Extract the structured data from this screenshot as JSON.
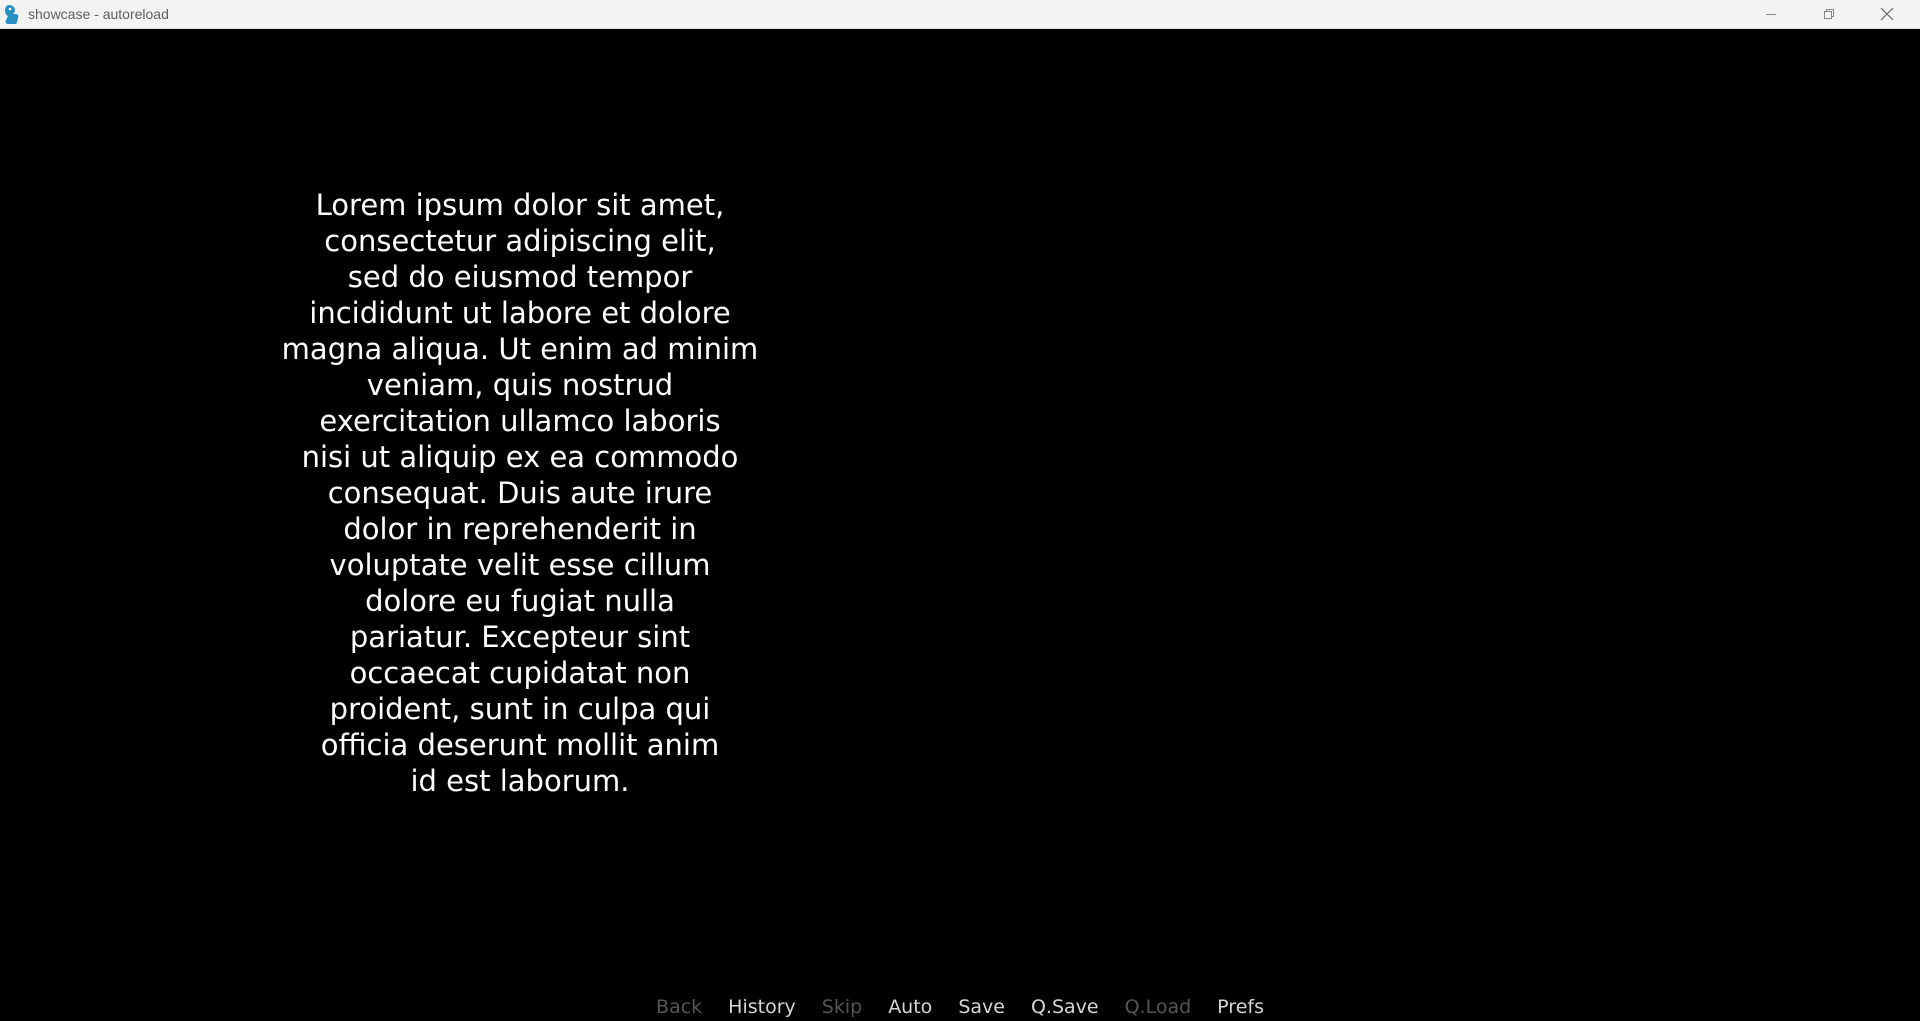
{
  "window": {
    "title": "showcase - autoreload",
    "icon": "renpy-app-icon",
    "controls": [
      "minimize-icon",
      "restore-icon",
      "close-icon"
    ]
  },
  "dialogue": {
    "text": "Lorem ipsum dolor sit amet,\nconsectetur adipiscing elit,\nsed do eiusmod tempor\nincididunt ut labore et dolore\nmagna aliqua. Ut enim ad minim\nveniam, quis nostrud\nexercitation ullamco laboris\nnisi ut aliquip ex ea commodo\nconsequat. Duis aute irure\ndolor in reprehenderit in\nvoluptate velit esse cillum\ndolore eu fugiat nulla\npariatur. Excepteur sint\noccaecat cupidatat non\nproident, sunt in culpa qui\nofficia deserunt mollit anim\nid est laborum."
  },
  "quick_menu": {
    "back": "Back",
    "history": "History",
    "skip": "Skip",
    "auto": "Auto",
    "save": "Save",
    "qsave": "Q.Save",
    "qload": "Q.Load",
    "prefs": "Prefs"
  },
  "colors": {
    "background": "#000000",
    "text": "#ffffff",
    "menu_enabled": "#d6d6d6",
    "menu_disabled": "#555555",
    "titlebar": "#f3f3f3"
  }
}
